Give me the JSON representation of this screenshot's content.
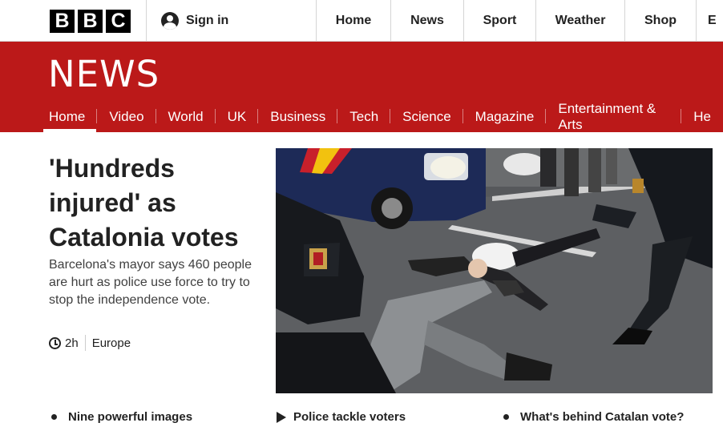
{
  "brand": {
    "logo_letters": [
      "B",
      "B",
      "C"
    ]
  },
  "account": {
    "signin_label": "Sign in"
  },
  "top_nav": [
    "Home",
    "News",
    "Sport",
    "Weather",
    "Shop",
    "E"
  ],
  "section": {
    "wordmark": "NEWS",
    "subnav": [
      "Home",
      "Video",
      "World",
      "UK",
      "Business",
      "Tech",
      "Science",
      "Magazine",
      "Entertainment & Arts",
      "He"
    ],
    "active": "Home"
  },
  "story": {
    "headline": "'Hundreds injured' as Catalonia votes",
    "summary": "Barcelona's mayor says 460 people are hurt as police use force to try to stop the independence vote.",
    "time": "2h",
    "region": "Europe"
  },
  "related": [
    {
      "label": "Nine powerful images",
      "icon": "bullet-icon"
    },
    {
      "label": "Police tackle voters",
      "icon": "play-icon"
    },
    {
      "label": "What's behind Catalan vote?",
      "icon": "bullet-icon"
    }
  ],
  "colors": {
    "brand_red": "#bb1919",
    "text": "#222222"
  }
}
